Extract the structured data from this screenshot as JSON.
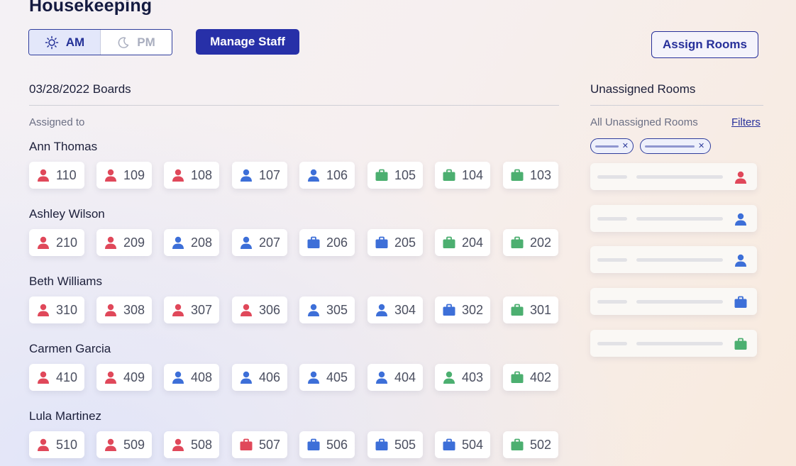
{
  "header": {
    "title": "Housekeeping",
    "shift_am": "AM",
    "shift_pm": "PM",
    "manage_staff": "Manage Staff",
    "assign_rooms": "Assign Rooms"
  },
  "boards": {
    "title": "03/28/2022 Boards",
    "assigned_label": "Assigned to"
  },
  "colors": {
    "red": "#e0485a",
    "blue": "#3d6fd8",
    "green": "#4caf70",
    "primary": "#2730a8"
  },
  "icons": {
    "person": "person-icon",
    "suitcase": "suitcase-icon",
    "sun": "sun-icon",
    "moon": "moon-icon"
  },
  "staff": [
    {
      "name": "Ann Thomas",
      "rooms": [
        {
          "number": "110",
          "icon": "person",
          "color": "red"
        },
        {
          "number": "109",
          "icon": "person",
          "color": "red"
        },
        {
          "number": "108",
          "icon": "person",
          "color": "red"
        },
        {
          "number": "107",
          "icon": "person",
          "color": "blue"
        },
        {
          "number": "106",
          "icon": "person",
          "color": "blue"
        },
        {
          "number": "105",
          "icon": "suitcase",
          "color": "green"
        },
        {
          "number": "104",
          "icon": "suitcase",
          "color": "green"
        },
        {
          "number": "103",
          "icon": "suitcase",
          "color": "green"
        }
      ]
    },
    {
      "name": "Ashley Wilson",
      "rooms": [
        {
          "number": "210",
          "icon": "person",
          "color": "red"
        },
        {
          "number": "209",
          "icon": "person",
          "color": "red"
        },
        {
          "number": "208",
          "icon": "person",
          "color": "blue"
        },
        {
          "number": "207",
          "icon": "person",
          "color": "blue"
        },
        {
          "number": "206",
          "icon": "suitcase",
          "color": "blue"
        },
        {
          "number": "205",
          "icon": "suitcase",
          "color": "blue"
        },
        {
          "number": "204",
          "icon": "suitcase",
          "color": "green"
        },
        {
          "number": "202",
          "icon": "suitcase",
          "color": "green"
        }
      ]
    },
    {
      "name": "Beth Williams",
      "rooms": [
        {
          "number": "310",
          "icon": "person",
          "color": "red"
        },
        {
          "number": "308",
          "icon": "person",
          "color": "red"
        },
        {
          "number": "307",
          "icon": "person",
          "color": "red"
        },
        {
          "number": "306",
          "icon": "person",
          "color": "red"
        },
        {
          "number": "305",
          "icon": "person",
          "color": "blue"
        },
        {
          "number": "304",
          "icon": "person",
          "color": "blue"
        },
        {
          "number": "302",
          "icon": "suitcase",
          "color": "blue"
        },
        {
          "number": "301",
          "icon": "suitcase",
          "color": "green"
        }
      ]
    },
    {
      "name": "Carmen Garcia",
      "rooms": [
        {
          "number": "410",
          "icon": "person",
          "color": "red"
        },
        {
          "number": "409",
          "icon": "person",
          "color": "red"
        },
        {
          "number": "408",
          "icon": "person",
          "color": "blue"
        },
        {
          "number": "406",
          "icon": "person",
          "color": "blue"
        },
        {
          "number": "405",
          "icon": "person",
          "color": "blue"
        },
        {
          "number": "404",
          "icon": "person",
          "color": "blue"
        },
        {
          "number": "403",
          "icon": "person",
          "color": "green"
        },
        {
          "number": "402",
          "icon": "suitcase",
          "color": "green"
        }
      ]
    },
    {
      "name": "Lula Martinez",
      "rooms": [
        {
          "number": "510",
          "icon": "person",
          "color": "red"
        },
        {
          "number": "509",
          "icon": "person",
          "color": "red"
        },
        {
          "number": "508",
          "icon": "person",
          "color": "red"
        },
        {
          "number": "507",
          "icon": "suitcase",
          "color": "red"
        },
        {
          "number": "506",
          "icon": "suitcase",
          "color": "blue"
        },
        {
          "number": "505",
          "icon": "suitcase",
          "color": "blue"
        },
        {
          "number": "504",
          "icon": "suitcase",
          "color": "blue"
        },
        {
          "number": "502",
          "icon": "suitcase",
          "color": "green"
        }
      ]
    }
  ],
  "unassigned": {
    "title": "Unassigned Rooms",
    "subtitle": "All Unassigned Rooms",
    "filters_label": "Filters",
    "cards": [
      {
        "icon": "person",
        "color": "red"
      },
      {
        "icon": "person",
        "color": "blue"
      },
      {
        "icon": "person",
        "color": "blue"
      },
      {
        "icon": "suitcase",
        "color": "blue"
      },
      {
        "icon": "suitcase",
        "color": "green"
      }
    ]
  }
}
